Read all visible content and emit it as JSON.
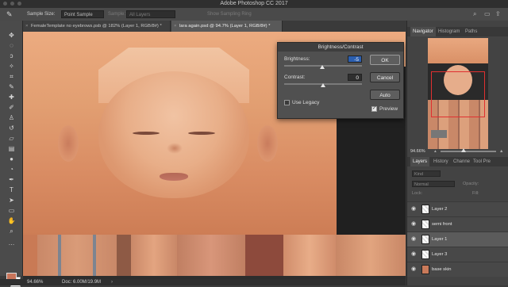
{
  "window": {
    "title": "Adobe Photoshop CC 2017"
  },
  "options_bar": {
    "sample_size_label": "Sample Size:",
    "sample_size_value": "Point Sample",
    "sample_label": "Sample:",
    "sample_value": "All Layers",
    "show_ring_label": "Show Sampling Ring"
  },
  "doc_tabs": [
    {
      "label": "FemaleTemplate no eyebrows.psb @ 182% (Layer 1, RGB/8#) *",
      "active": false
    },
    {
      "label": "lara again.psd @ 94.7% (Layer 1, RGB/8#) *",
      "active": true
    }
  ],
  "status": {
    "zoom": "94.66%",
    "doc": "Doc: 6.00M/19.9M"
  },
  "dialog": {
    "title": "Brightness/Contrast",
    "brightness_label": "Brightness:",
    "brightness_value": "-5",
    "contrast_label": "Contrast:",
    "contrast_value": "0",
    "legacy_label": "Use Legacy",
    "ok": "OK",
    "cancel": "Cancel",
    "auto": "Auto",
    "preview": "Preview"
  },
  "navigator": {
    "tabs": [
      "Navigator",
      "Histogram",
      "Paths"
    ],
    "zoom": "94.66%"
  },
  "layers": {
    "tabs": [
      "Layers",
      "History",
      "Channe",
      "Tool Pre"
    ],
    "kind": "Kind",
    "blend": "Normal",
    "opacity_label": "Opacity:",
    "lock_label": "Lock:",
    "fill_label": "Fill:",
    "items": [
      {
        "name": "Layer 2",
        "selected": false
      },
      {
        "name": "semi front",
        "selected": false
      },
      {
        "name": "Layer 1",
        "selected": true
      },
      {
        "name": "Layer 3",
        "selected": false
      },
      {
        "name": "base skin",
        "selected": false
      }
    ]
  },
  "colors": {
    "foreground": "#c8745a",
    "background": "#ffffff",
    "accent": "#2b5fb0"
  }
}
